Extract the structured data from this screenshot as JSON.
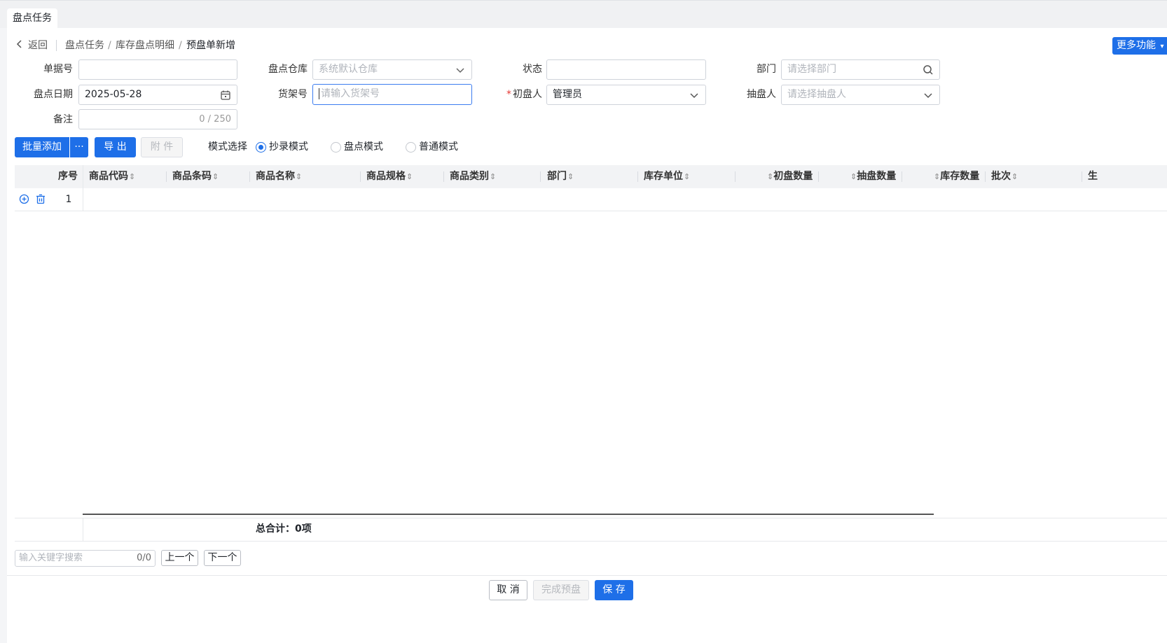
{
  "tab": {
    "label": "盘点任务"
  },
  "nav": {
    "back": "返回",
    "breadcrumb": [
      "盘点任务",
      "库存盘点明细",
      "预盘单新增"
    ],
    "separator": "/"
  },
  "header": {
    "more_button": "更多功能"
  },
  "form": {
    "doc_no": {
      "label": "单据号",
      "value": ""
    },
    "warehouse": {
      "label": "盘点仓库",
      "placeholder": "系统默认仓库"
    },
    "status": {
      "label": "状态",
      "value": ""
    },
    "department": {
      "label": "部门",
      "placeholder": "请选择部门"
    },
    "date": {
      "label": "盘点日期",
      "value": "2025-05-28"
    },
    "shelf": {
      "label": "货架号",
      "placeholder": "请输入货架号"
    },
    "first_counter": {
      "required_mark": "*",
      "label": "初盘人",
      "value": "管理员"
    },
    "spot_checker": {
      "label": "抽盘人",
      "placeholder": "请选择抽盘人"
    },
    "remark": {
      "label": "备注",
      "counter": "0 / 250"
    }
  },
  "toolbar": {
    "batch_add": "批量添加",
    "batch_more": "···",
    "export": "导 出",
    "attachment": "附 件",
    "mode_label": "模式选择",
    "modes": [
      "抄录模式",
      "盘点模式",
      "普通模式"
    ],
    "selected_mode": 0
  },
  "table": {
    "columns": [
      "序号",
      "商品代码",
      "商品条码",
      "商品名称",
      "商品规格",
      "商品类别",
      "部门",
      "库存单位",
      "初盘数量",
      "抽盘数量",
      "库存数量",
      "批次",
      "生"
    ],
    "rows": [
      {
        "index": "1"
      }
    ],
    "total_label": "总合计：0项"
  },
  "search": {
    "placeholder": "输入关键字搜索",
    "count": "0/0",
    "prev": "上一个",
    "next": "下一个"
  },
  "footer": {
    "cancel": "取 消",
    "finish": "完成预盘",
    "save": "保 存"
  },
  "colors": {
    "primary": "#1e6fe8",
    "required": "#e53935"
  }
}
